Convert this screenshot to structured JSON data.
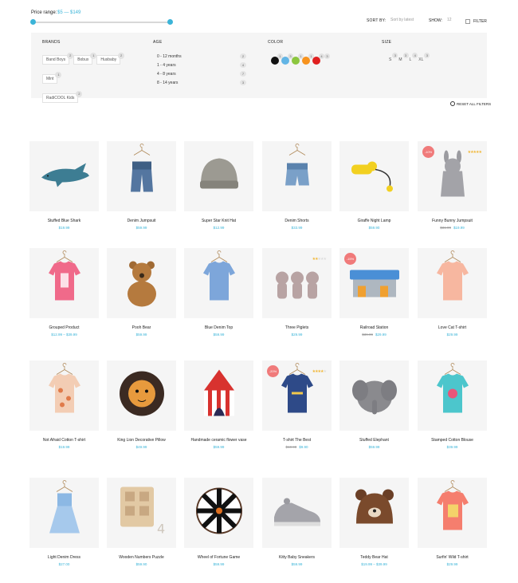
{
  "price_range": {
    "label": "Price range:",
    "value": "$5 — $149",
    "min_fraction": 0.0,
    "max_fraction": 1.0
  },
  "toolbar": {
    "sort_label": "SORT BY:",
    "sort_value": "Sort by latest",
    "show_label": "SHOW:",
    "show_value": "12",
    "filter_label": "FILTER"
  },
  "filters": {
    "brands": {
      "title": "BRANDS",
      "items": [
        {
          "label": "Band Boys",
          "count": "2"
        },
        {
          "label": "Bobux",
          "count": "1"
        },
        {
          "label": "Husbaby",
          "count": "2"
        },
        {
          "label": "Mint",
          "count": "1"
        },
        {
          "label": "RadiCOOL Kids",
          "count": "2"
        }
      ]
    },
    "age": {
      "title": "AGE",
      "items": [
        {
          "label": "0 - 12 months",
          "count": "2"
        },
        {
          "label": "1 - 4 years",
          "count": "4"
        },
        {
          "label": "4 - 8 years",
          "count": "7"
        },
        {
          "label": "8 - 14 years",
          "count": "3"
        }
      ]
    },
    "color": {
      "title": "COLOR",
      "items": [
        {
          "name": "black",
          "hex": "#111111",
          "count": "1"
        },
        {
          "name": "blue",
          "hex": "#62b5e5",
          "count": "3"
        },
        {
          "name": "green",
          "hex": "#8cc63f",
          "count": "1"
        },
        {
          "name": "orange",
          "hex": "#f7931e",
          "count": "1"
        },
        {
          "name": "red",
          "hex": "#e02020",
          "count": "4"
        },
        {
          "name": "extra",
          "hex": "",
          "count": "3"
        }
      ]
    },
    "size": {
      "title": "SIZE",
      "items": [
        {
          "label": "S",
          "count": "3"
        },
        {
          "label": "M",
          "count": "3"
        },
        {
          "label": "L",
          "count": "4"
        },
        {
          "label": "XL",
          "count": "3"
        }
      ]
    },
    "reset_label": "RESET ALL FILTERS"
  },
  "products": [
    {
      "name": "Stuffed Blue Shark",
      "price": "$19.99",
      "old_price": "",
      "sale": "",
      "rating": 0,
      "icon": "shark"
    },
    {
      "name": "Denim Jumpsuit",
      "price": "$59.99",
      "old_price": "",
      "sale": "",
      "rating": 0,
      "icon": "jeans"
    },
    {
      "name": "Super Star Knit Hat",
      "price": "$12.99",
      "old_price": "",
      "sale": "",
      "rating": 0,
      "icon": "hat"
    },
    {
      "name": "Denim Shorts",
      "price": "$33.99",
      "old_price": "",
      "sale": "",
      "rating": 0,
      "icon": "shorts"
    },
    {
      "name": "Giraffe Night Lamp",
      "price": "$59.90",
      "old_price": "",
      "sale": "",
      "rating": 0,
      "icon": "lamp"
    },
    {
      "name": "Funny Bunny Jumpsuit",
      "price": "$19.99",
      "old_price": "$31.99",
      "sale": "-10%",
      "rating": 5,
      "icon": "bunny"
    },
    {
      "name": "Grouped Product",
      "price": "$12.99 – $39.99",
      "old_price": "",
      "sale": "",
      "rating": 0,
      "icon": "pink-shirt"
    },
    {
      "name": "Pooh Bear",
      "price": "$59.99",
      "old_price": "",
      "sale": "",
      "rating": 0,
      "icon": "bear"
    },
    {
      "name": "Blue Denim Top",
      "price": "$59.99",
      "old_price": "",
      "sale": "",
      "rating": 0,
      "icon": "blue-top"
    },
    {
      "name": "Three Piglets",
      "price": "$29.99",
      "old_price": "",
      "sale": "",
      "rating": 2,
      "icon": "piglets"
    },
    {
      "name": "Railroad Station",
      "price": "$29.99",
      "old_price": "$39.99",
      "sale": "-15%",
      "rating": 0,
      "icon": "station"
    },
    {
      "name": "Love Cat T-shirt",
      "price": "$29.99",
      "old_price": "",
      "sale": "",
      "rating": 0,
      "icon": "peach-shirt"
    },
    {
      "name": "Not Afraid Cotton T-shirt",
      "price": "$19.99",
      "old_price": "",
      "sale": "",
      "rating": 0,
      "icon": "tee-cream"
    },
    {
      "name": "King Lion Decorative Pillow",
      "price": "$49.99",
      "old_price": "",
      "sale": "",
      "rating": 0,
      "icon": "lion"
    },
    {
      "name": "Handmade ceramic flower vase",
      "price": "$59.99",
      "old_price": "",
      "sale": "",
      "rating": 0,
      "icon": "tent"
    },
    {
      "name": "T-shirt The Best",
      "price": "$9.90",
      "old_price": "$10.90",
      "sale": "-20%",
      "rating": 4,
      "icon": "navy-tee"
    },
    {
      "name": "Stuffed Elephant",
      "price": "$59.99",
      "old_price": "",
      "sale": "",
      "rating": 0,
      "icon": "elephant"
    },
    {
      "name": "Stamped Cotton Blouse",
      "price": "$39.99",
      "old_price": "",
      "sale": "",
      "rating": 0,
      "icon": "teal-shirt"
    },
    {
      "name": "Light Denim Dress",
      "price": "$27.00",
      "old_price": "",
      "sale": "",
      "rating": 0,
      "icon": "dress"
    },
    {
      "name": "Wooden Numbers Puzzle",
      "price": "$59.90",
      "old_price": "",
      "sale": "",
      "rating": 0,
      "icon": "puzzle"
    },
    {
      "name": "Wheel of Fortune Game",
      "price": "$59.99",
      "old_price": "",
      "sale": "",
      "rating": 0,
      "icon": "wheel"
    },
    {
      "name": "Kitty Baby Sneakers",
      "price": "$59.99",
      "old_price": "",
      "sale": "",
      "rating": 0,
      "icon": "sneakers"
    },
    {
      "name": "Teddy Bear Hat",
      "price": "$19.99 – $39.99",
      "old_price": "",
      "sale": "",
      "rating": 0,
      "icon": "bear-hat"
    },
    {
      "name": "Surfin' Wild T-shirt",
      "price": "$29.99",
      "old_price": "",
      "sale": "",
      "rating": 0,
      "icon": "coral-tee"
    }
  ]
}
